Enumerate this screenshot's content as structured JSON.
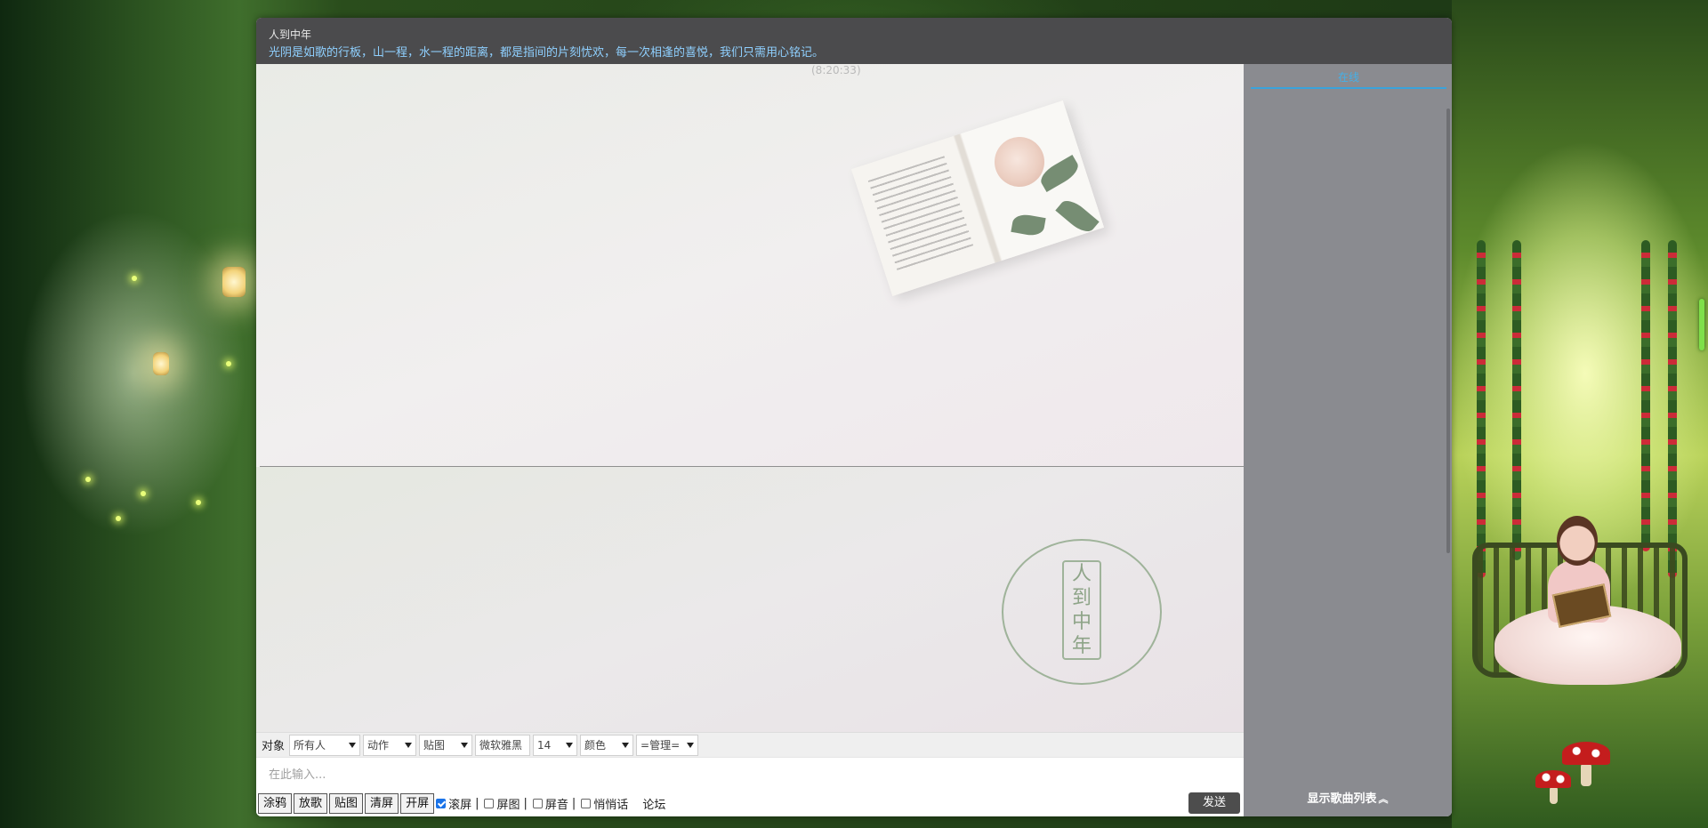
{
  "room": {
    "name": "人到中年",
    "motto": "光阴是如歌的行板，山一程，水一程的距离，都是指间的片刻忧欢，每一次相逢的喜悦，我们只需用心铭记。"
  },
  "chat": {
    "timestamp": "(8:20:33)"
  },
  "logo": {
    "text_lines": [
      "人",
      "到",
      "中",
      "年"
    ]
  },
  "toolbar": {
    "target_label": "对象",
    "target_value": "所有人",
    "action_value": "动作",
    "sticker_value": "贴图",
    "font_value": "微软雅黑",
    "size_value": "14",
    "color_value": "颜色",
    "admin_value": "=管理="
  },
  "input": {
    "placeholder": "在此输入..."
  },
  "bottom": {
    "doodle_label": "涂鸦",
    "play_song_label": "放歌",
    "post_image_label": "贴图",
    "clear_label": "清屏",
    "open_screen_label": "开屏",
    "scroll_label": "滚屏",
    "scroll_checked": true,
    "block_image_label": "屏图",
    "block_sound_label": "屏音",
    "whisper_label": "悄悄话",
    "separator": "|",
    "forum_label": "论坛",
    "send_label": "发送"
  },
  "sidebar": {
    "tab_online": "在线",
    "music_toggle_label": "显示歌曲列表",
    "music_toggle_icon": "chevron-up-icon"
  },
  "colors": {
    "header_bg": "#4b4b4d",
    "motto": "#8fd0ff",
    "sidebar_bg": "#8a8b90",
    "accent": "#3aa3dc",
    "send_bg": "#4d4d4d"
  }
}
